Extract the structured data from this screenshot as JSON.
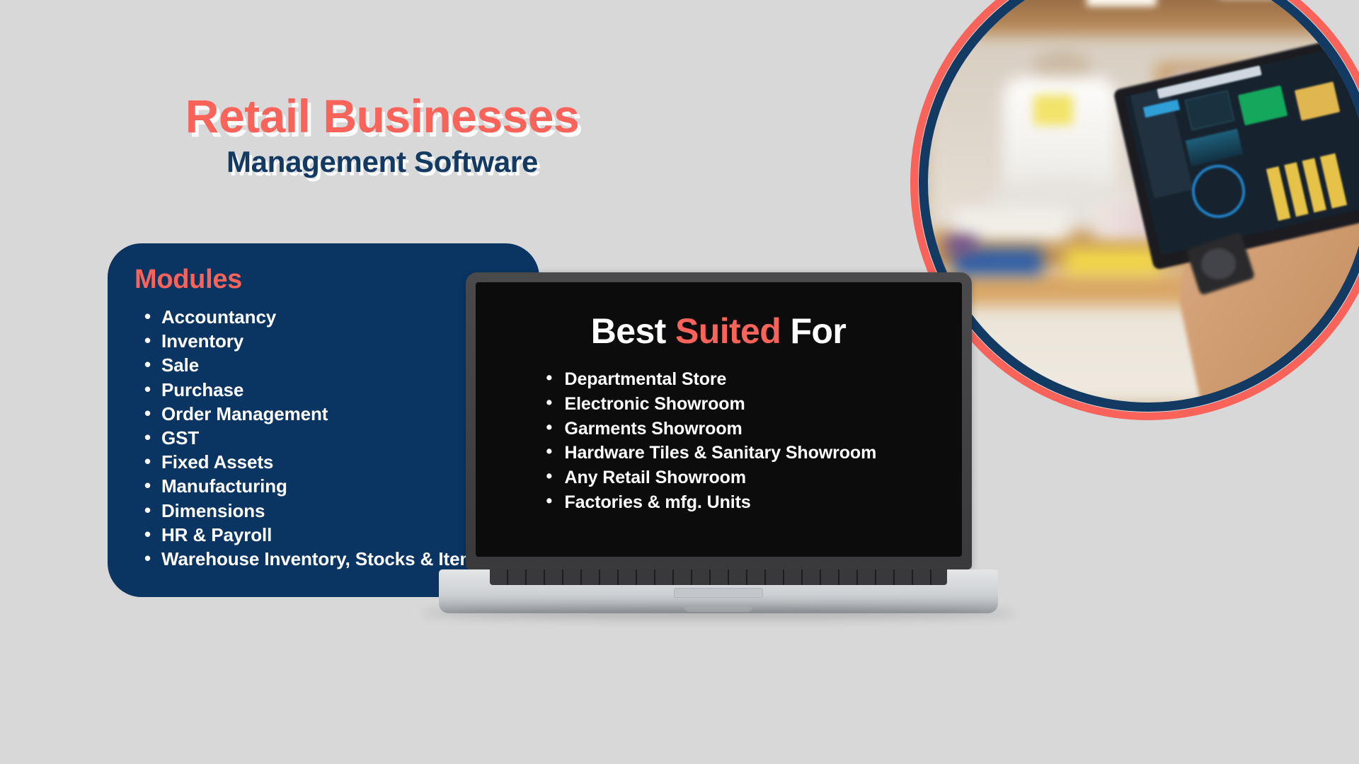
{
  "headline": {
    "title_main": "Retail Businesses",
    "title_sub": "Management Software"
  },
  "modules_card": {
    "heading": "Modules",
    "items": [
      "Accountancy",
      "Inventory",
      "Sale",
      "Purchase",
      "Order Management",
      "GST",
      "Fixed Assets",
      "Manufacturing",
      "Dimensions",
      "HR & Payroll",
      "Warehouse Inventory, Stocks & Items"
    ]
  },
  "laptop": {
    "screen_heading": {
      "before": "Best ",
      "highlight": "Suited",
      "after": " For"
    },
    "items": [
      "Departmental Store",
      "Electronic Showroom",
      "Garments Showroom",
      "Hardware Tiles & Sanitary Showroom",
      "Any Retail Showroom",
      "Factories & mfg. Units"
    ]
  },
  "photo": {
    "caption": "retail-store-tablet-dashboard-photo"
  },
  "colors": {
    "background": "#d8d8d8",
    "coral": "#f9635a",
    "navy": "#0a3563",
    "navy_text": "#123a63",
    "screen_black": "#0c0c0c",
    "white": "#ffffff"
  }
}
